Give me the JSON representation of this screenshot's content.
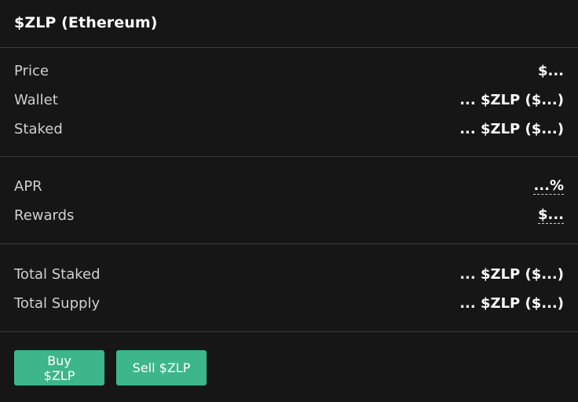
{
  "header": {
    "title": "$ZLP (Ethereum)"
  },
  "holdings": {
    "price_label": "Price",
    "price_value": "$...",
    "wallet_label": "Wallet",
    "wallet_value": "... $ZLP ($...)",
    "staked_label": "Staked",
    "staked_value": "... $ZLP ($...)"
  },
  "yield": {
    "apr_label": "APR",
    "apr_value": "...%",
    "rewards_label": "Rewards",
    "rewards_value": "$..."
  },
  "totals": {
    "total_staked_label": "Total Staked",
    "total_staked_value": "... $ZLP ($...)",
    "total_supply_label": "Total Supply",
    "total_supply_value": "... $ZLP ($...)"
  },
  "actions": {
    "buy_label": "Buy $ZLP",
    "sell_label": "Sell $ZLP"
  },
  "colors": {
    "background": "#161616",
    "divider": "#3b3b3b",
    "accent": "#3cb68a"
  }
}
